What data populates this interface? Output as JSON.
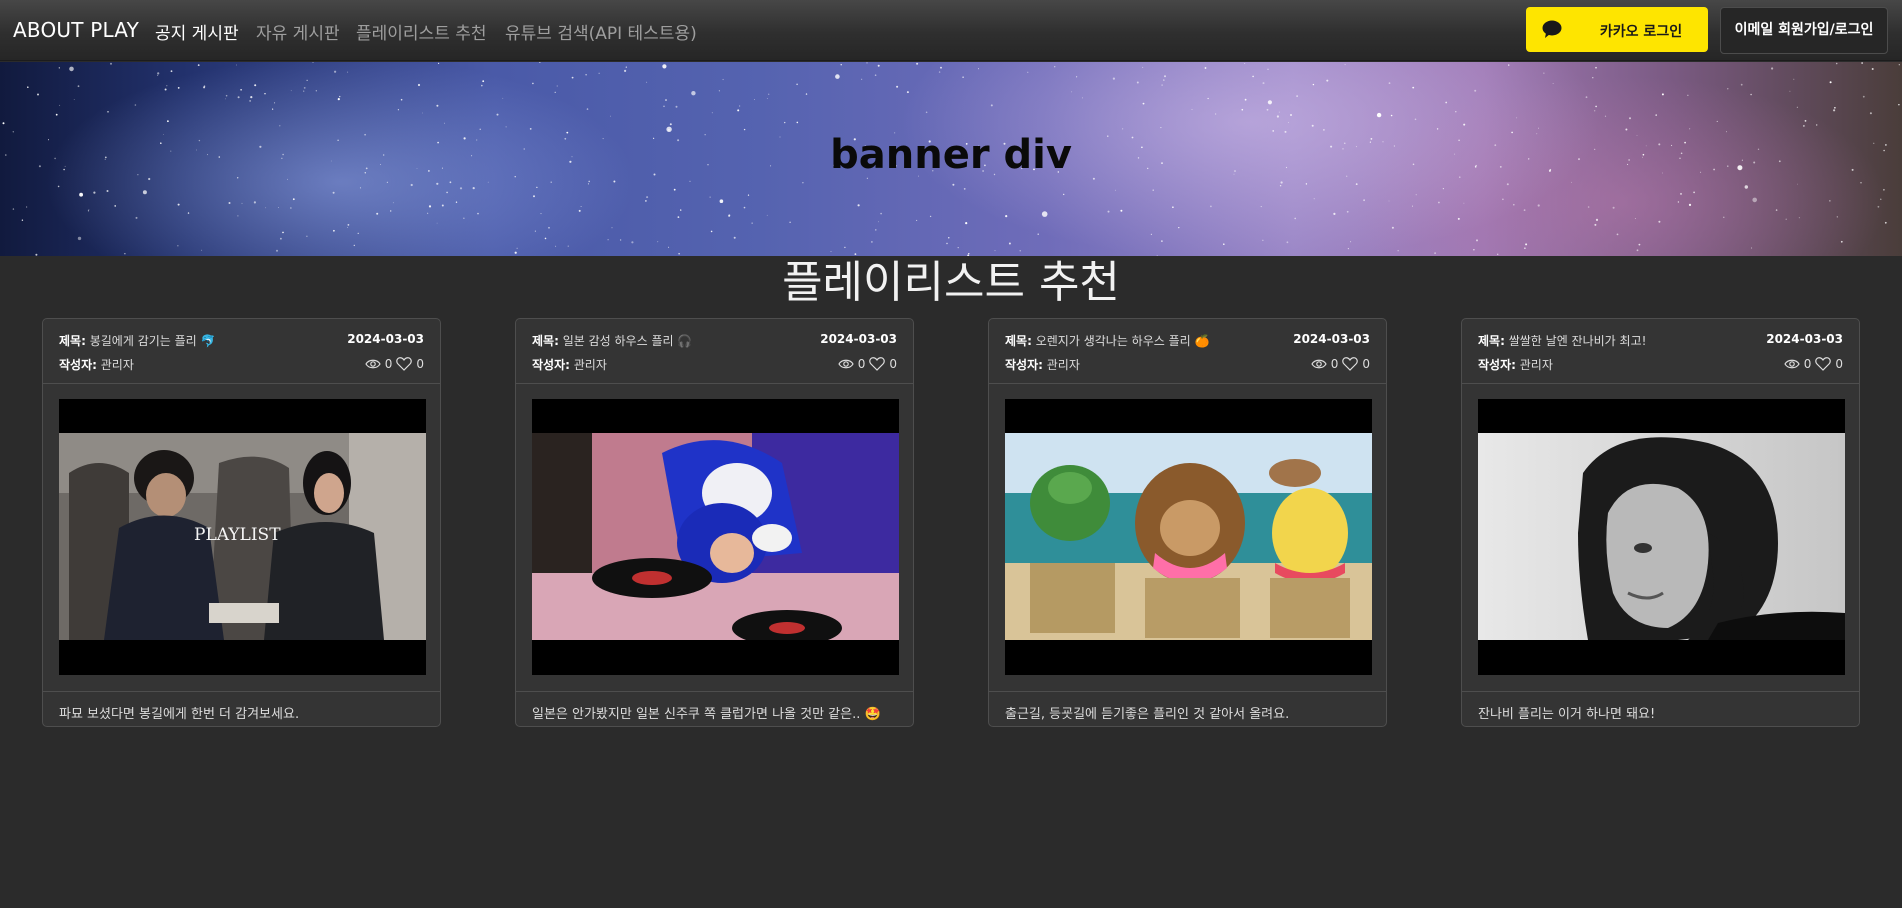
{
  "nav": {
    "brand": "ABOUT PLAY",
    "items": [
      {
        "label": "공지 게시판"
      },
      {
        "label": "자유 게시판"
      },
      {
        "label": "플레이리스트 추천"
      },
      {
        "label": "유튜브 검색(API 테스트용)"
      }
    ],
    "kakao_login": "카카오 로그인",
    "email_login": "이메일 회원가입/로그인"
  },
  "banner": {
    "title": "banner div"
  },
  "page_title": "플레이리스트 추천",
  "labels": {
    "title": "제목:",
    "author": "작성자:"
  },
  "cards": [
    {
      "title": "봉길에게 감기는 플리 🐬",
      "date": "2024-03-03",
      "author": "관리자",
      "views": "0",
      "likes": "0",
      "thumb_text": "PLAYLIST",
      "description": "파묘 보셨다면 봉길에게 한번 더 감겨보세요."
    },
    {
      "title": "일본 감성 하우스 플리 🎧",
      "date": "2024-03-03",
      "author": "관리자",
      "views": "0",
      "likes": "0",
      "description": "일본은 안가봤지만 일본 신주쿠 쪽 클럽가면 나올 것만 같은.. 🤩"
    },
    {
      "title": "오렌지가 생각나는 하우스 플리 🍊",
      "date": "2024-03-03",
      "author": "관리자",
      "views": "0",
      "likes": "0",
      "description": "출근길, 등굣길에 듣기좋은 플리인 것 같아서 올려요."
    },
    {
      "title": "쌀쌀한 날엔 잔나비가 최고!",
      "date": "2024-03-03",
      "author": "관리자",
      "views": "0",
      "likes": "0",
      "description": "잔나비 플리는 이거 하나면 돼요!"
    }
  ],
  "colors": {
    "background": "#2b2b2b",
    "card": "#343434",
    "kakao": "#fee500"
  },
  "icons": [
    "kakao-chat-icon",
    "eye-icon",
    "heart-icon"
  ]
}
